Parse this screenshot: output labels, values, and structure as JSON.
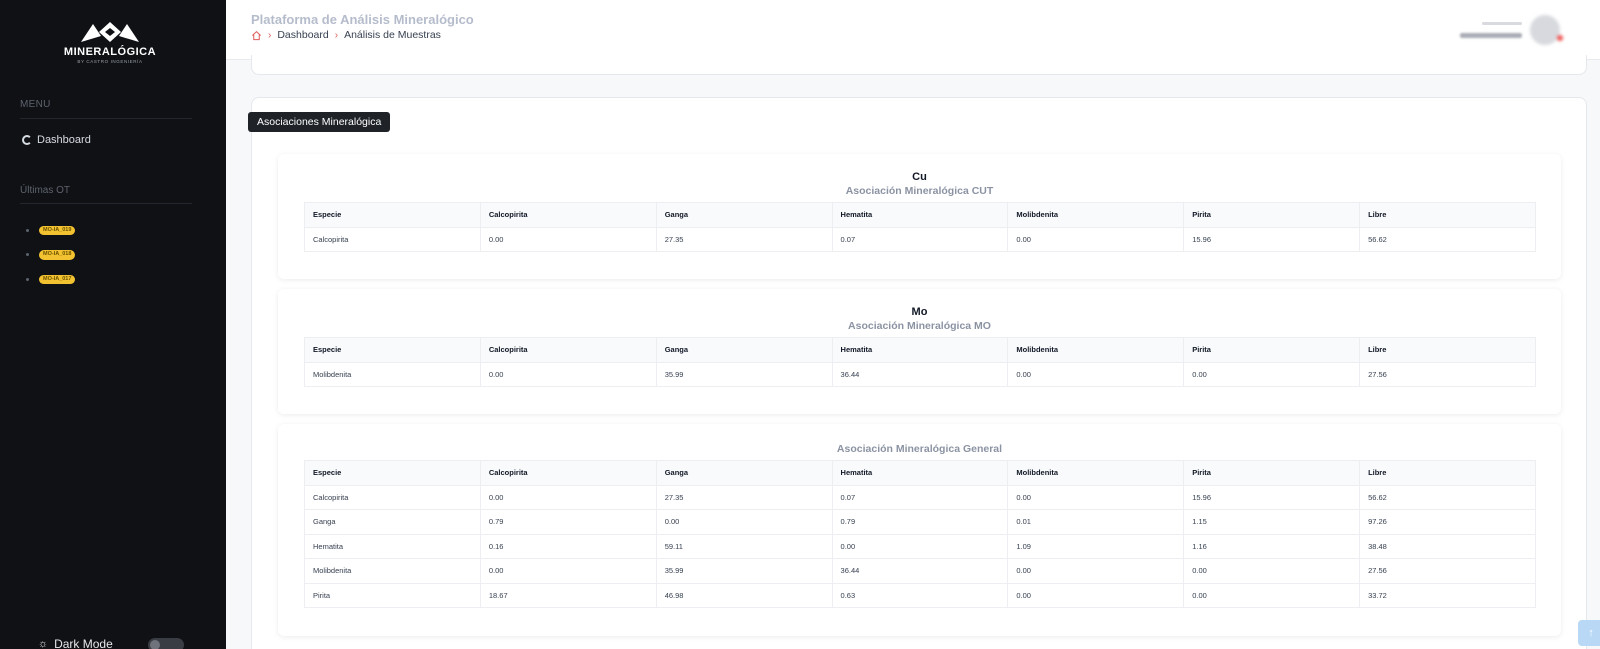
{
  "sidebar": {
    "logo_text": "MINERALÓGICA",
    "logo_sub": "BY CASTRO INGENIERÍA",
    "menu_header": "MENU",
    "nav": [
      {
        "label": "Dashboard",
        "icon": "dashboard-icon"
      }
    ],
    "ot_header": "Últimas OT",
    "ot_items": [
      "MO-IA_019",
      "MO-IA_018",
      "MO-IA_017"
    ],
    "dark_mode_label": "Dark Mode",
    "dark_mode_on": false
  },
  "header": {
    "title": "Plataforma de Análisis Mineralógico",
    "breadcrumb": [
      "Dashboard",
      "Análisis de Muestras"
    ]
  },
  "section": {
    "tag": "Asociaciones Mineralógica"
  },
  "columns": [
    "Especie",
    "Calcopirita",
    "Ganga",
    "Hematita",
    "Molibdenita",
    "Pirita",
    "Libre"
  ],
  "cards": [
    {
      "title": "Cu",
      "subtitle": "Asociación Mineralógica CUT",
      "rows": [
        [
          "Calcopirita",
          "0.00",
          "27.35",
          "0.07",
          "0.00",
          "15.96",
          "56.62"
        ]
      ]
    },
    {
      "title": "Mo",
      "subtitle": "Asociación Mineralógica MO",
      "rows": [
        [
          "Molibdenita",
          "0.00",
          "35.99",
          "36.44",
          "0.00",
          "0.00",
          "27.56"
        ]
      ]
    },
    {
      "title": "",
      "subtitle": "Asociación Mineralógica General",
      "rows": [
        [
          "Calcopirita",
          "0.00",
          "27.35",
          "0.07",
          "0.00",
          "15.96",
          "56.62"
        ],
        [
          "Ganga",
          "0.79",
          "0.00",
          "0.79",
          "0.01",
          "1.15",
          "97.26"
        ],
        [
          "Hematita",
          "0.16",
          "59.11",
          "0.00",
          "1.09",
          "1.16",
          "38.48"
        ],
        [
          "Molibdenita",
          "0.00",
          "35.99",
          "36.44",
          "0.00",
          "0.00",
          "27.56"
        ],
        [
          "Pirita",
          "18.67",
          "46.98",
          "0.63",
          "0.00",
          "0.00",
          "33.72"
        ]
      ]
    }
  ],
  "colors": {
    "sidebar_bg": "#0f1115",
    "badge": "#f2c230",
    "accent": "#e05a5a"
  }
}
